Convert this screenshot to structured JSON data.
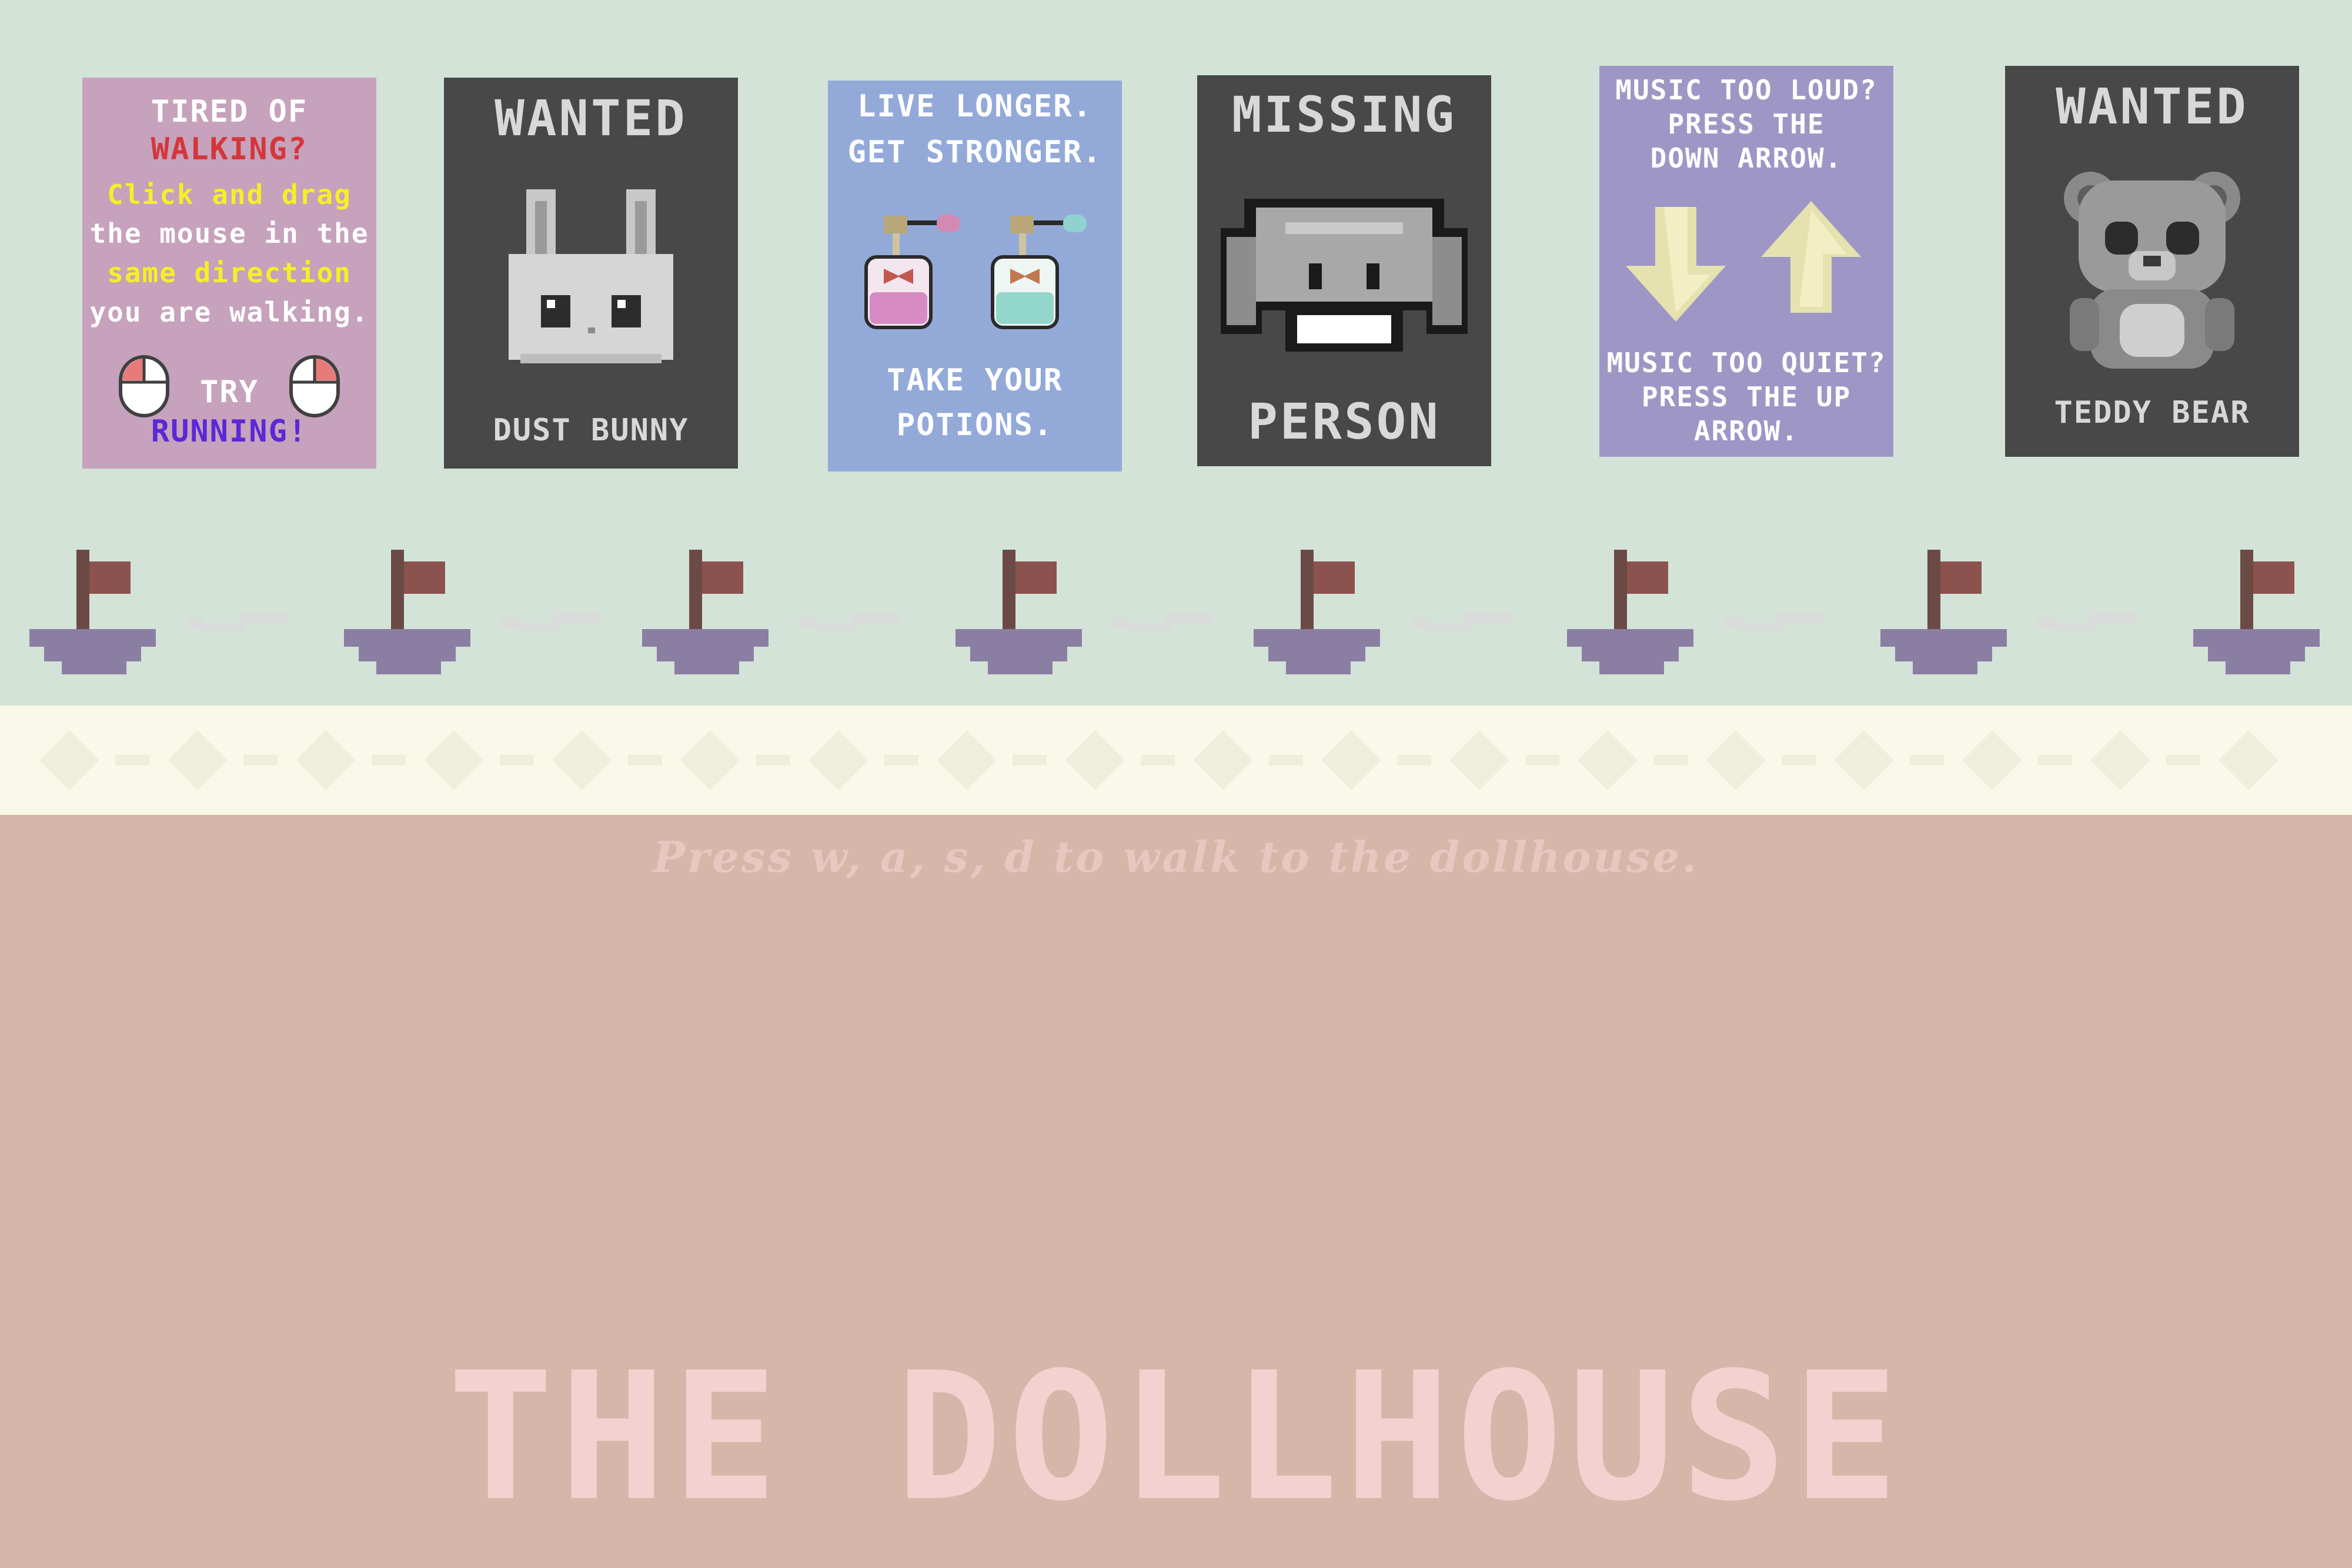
{
  "posters": [
    {
      "line1": "TIRED OF",
      "line2": "WALKING?",
      "line3": "Click and drag",
      "line4": "the mouse in the",
      "line5": "same direction",
      "line6": "you are walking.",
      "line7": "TRY",
      "line8": "RUNNING!"
    },
    {
      "header": "WANTED",
      "footer": "DUST BUNNY"
    },
    {
      "line1": "LIVE LONGER.",
      "line2": "GET STRONGER.",
      "line3": "TAKE YOUR",
      "line4": "POTIONS."
    },
    {
      "header": "MISSING",
      "footer": "PERSON"
    },
    {
      "line1": "MUSIC TOO LOUD?",
      "line2": "PRESS THE",
      "line3": "DOWN ARROW.",
      "line4": "MUSIC TOO QUIET?",
      "line5": "PRESS THE UP",
      "line6": "ARROW."
    },
    {
      "header": "WANTED",
      "footer": "TEDDY BEAR"
    }
  ],
  "hint": "Press w, a, s, d to walk to the dollhouse.",
  "title": "THE DOLLHOUSE",
  "colors": {
    "wall": "#d3e3d8",
    "trim": "#faf9e9",
    "floor": "#d6b6a8",
    "title": "#f2d2d0"
  }
}
